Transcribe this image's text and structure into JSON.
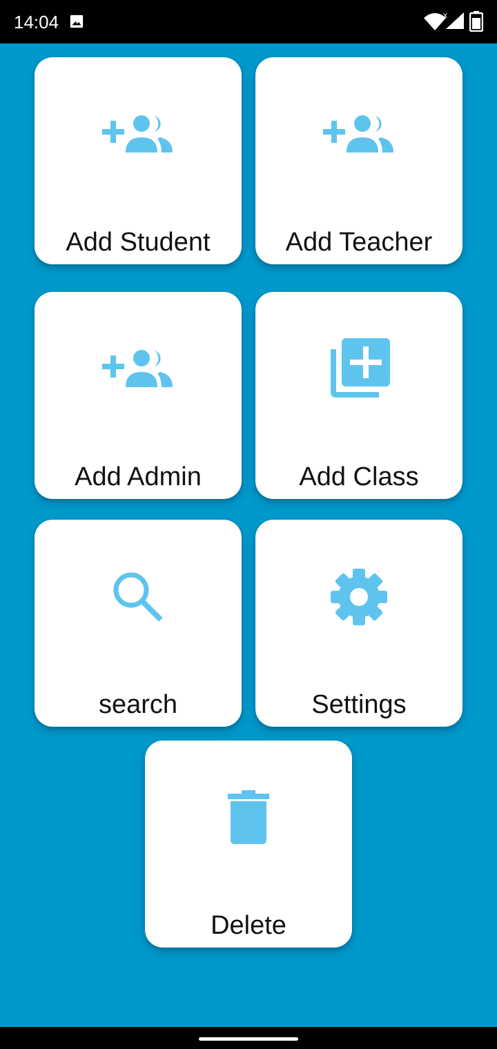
{
  "status_bar": {
    "time": "14:04",
    "icons": [
      "image-notification-icon",
      "wifi-icon",
      "cell-signal-icon",
      "battery-icon"
    ]
  },
  "colors": {
    "background": "#0099cc",
    "tile": "#ffffff",
    "icon": "#5ec4ee",
    "label": "#111111"
  },
  "tiles": [
    {
      "label": "Add Student",
      "icon": "add-group-icon"
    },
    {
      "label": "Add Teacher",
      "icon": "add-group-icon"
    },
    {
      "label": "Add Admin",
      "icon": "add-group-icon"
    },
    {
      "label": "Add Class",
      "icon": "library-add-icon"
    },
    {
      "label": "search",
      "icon": "search-icon"
    },
    {
      "label": "Settings",
      "icon": "gear-icon"
    },
    {
      "label": "Delete",
      "icon": "trash-icon"
    }
  ]
}
